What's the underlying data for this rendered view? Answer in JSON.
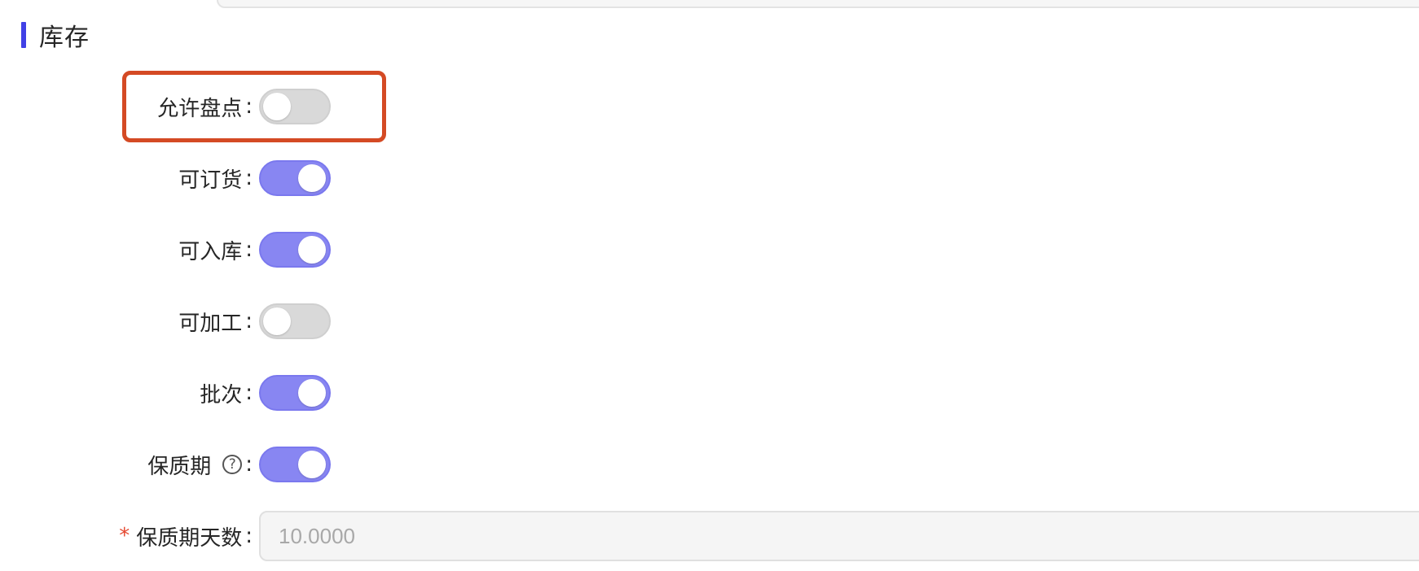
{
  "section": {
    "title": "库存"
  },
  "fields": {
    "allow_inventory_count": {
      "label": "允许盘点",
      "enabled": false
    },
    "orderable": {
      "label": "可订货",
      "enabled": true
    },
    "storable": {
      "label": "可入库",
      "enabled": true
    },
    "processable": {
      "label": "可加工",
      "enabled": false
    },
    "batch": {
      "label": "批次",
      "enabled": true
    },
    "shelf_life": {
      "label": "保质期",
      "help": "?",
      "enabled": true
    },
    "shelf_life_days": {
      "label": "保质期天数",
      "required_mark": "*",
      "value": "10.0000"
    }
  },
  "colon": ":",
  "colors": {
    "accent": "#4141e6",
    "toggle_on": "#8886f2",
    "toggle_off": "#d9d9d9",
    "highlight": "#d44a24",
    "required": "#e54a33"
  }
}
